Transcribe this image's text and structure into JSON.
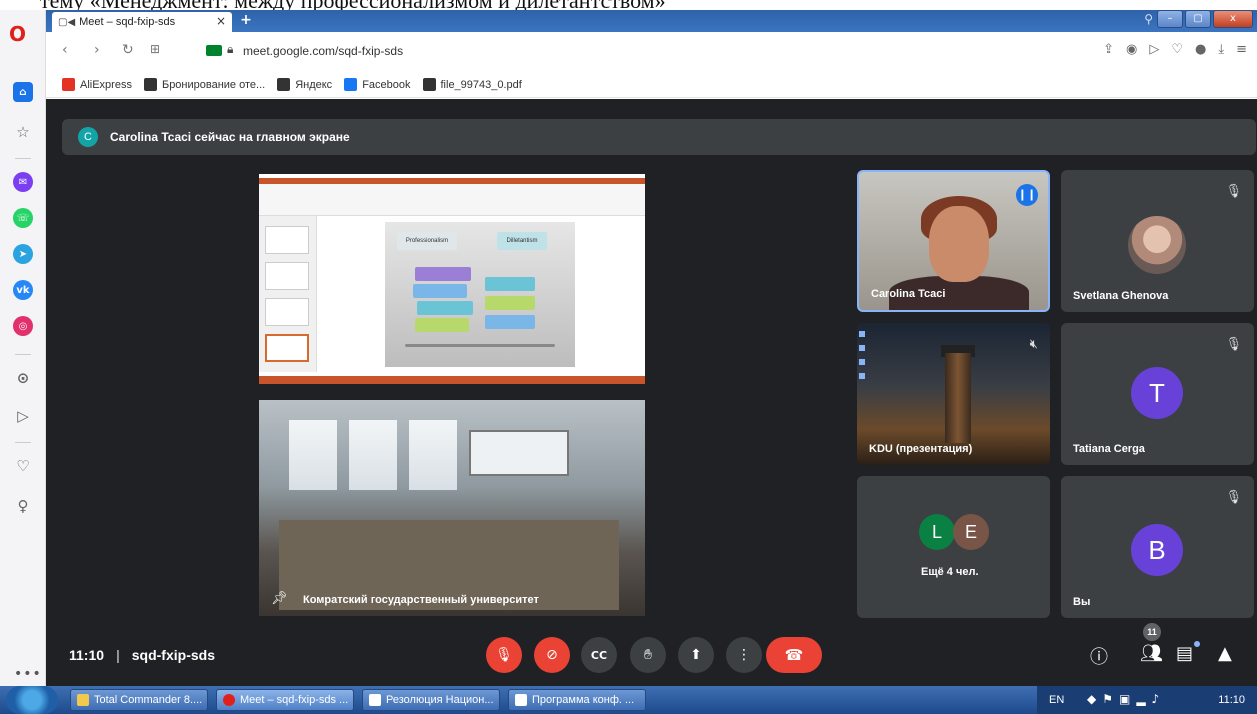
{
  "caption": "тему «Менеджмент: между профессионализмом и дилетантством»",
  "browser": {
    "tab_title": "Meet – sqd-fxip-sds",
    "tab_close": "×",
    "tab_add": "+",
    "url": "meet.google.com/sqd-fxip-sds",
    "bookmarks": [
      {
        "label": "AliExpress",
        "color": "#e43225"
      },
      {
        "label": "Бронирование оте...",
        "color": "#333333"
      },
      {
        "label": "Яндекс",
        "color": "#333333"
      },
      {
        "label": "Facebook",
        "color": "#1877f2"
      },
      {
        "label": "file_99743_0.pdf",
        "color": "#333333"
      }
    ]
  },
  "meet": {
    "banner_avatar": "C",
    "banner_text": "Carolina Tcaci сейчас на главном экране",
    "room_name": "Комратский государственный университет",
    "participants": {
      "carolina": "Carolina Tcaci",
      "svetlana": "Svetlana Ghenova",
      "kdu": "KDU (презентация)",
      "tatiana": "Tatiana Cerga",
      "tatiana_initial": "T",
      "more_label": "Ещё 4 чел.",
      "more_initials": [
        "L",
        "E"
      ],
      "you": "Вы",
      "you_initial": "B"
    },
    "slide": {
      "left_header": "Professionalism",
      "right_header": "Dilletantism"
    },
    "controls": {
      "time": "11:10",
      "meeting_code": "sqd-fxip-sds",
      "people_count": "11"
    }
  },
  "taskbar": {
    "items": [
      {
        "label": "Total Commander 8....",
        "color": "#f2c94c"
      },
      {
        "label": "Meet – sqd-fxip-sds ...",
        "color": "#e0201b"
      },
      {
        "label": "Резолюция Национ...",
        "color": "#ffffff"
      },
      {
        "label": "Программа конф. ...",
        "color": "#ffffff"
      }
    ],
    "lang": "EN",
    "clock": "11:10"
  },
  "colors": {
    "meet_bg": "#202124",
    "red": "#ea4335",
    "accent_blue": "#1a73e8"
  }
}
